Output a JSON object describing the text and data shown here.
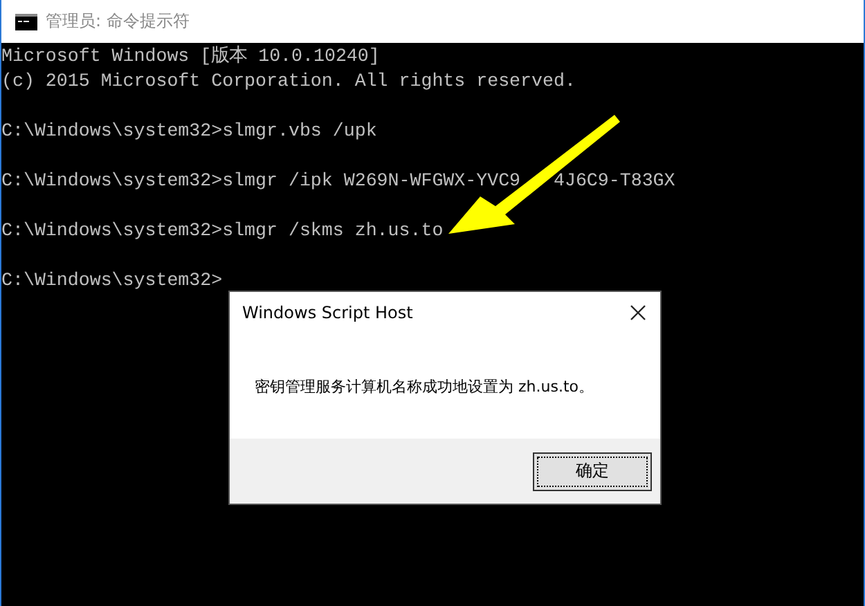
{
  "window": {
    "title": "管理员: 命令提示符"
  },
  "console": {
    "lines": [
      {
        "kind": "output",
        "parts": [
          "Microsoft Windows [版本 10.0.10240]"
        ]
      },
      {
        "kind": "output",
        "parts": [
          "(c) 2015 Microsoft Corporation. All rights reserved."
        ]
      },
      {
        "kind": "prompt",
        "parts": [
          "C:\\Windows\\system32>slmgr.vbs /upk"
        ]
      },
      {
        "kind": "prompt",
        "parts": [
          "C:\\Windows\\system32>slmgr /ipk W269N-WFGWX-YVC9",
          "4J6C9-T83GX"
        ]
      },
      {
        "kind": "prompt",
        "parts": [
          "C:\\Windows\\system32>slmgr /skms zh.us.to"
        ]
      },
      {
        "kind": "prompt",
        "parts": [
          "C:\\Windows\\system32>"
        ]
      }
    ]
  },
  "dialog": {
    "title": "Windows Script Host",
    "message": "密钥管理服务计算机名称成功地设置为 zh.us.to。",
    "buttons": [
      {
        "label": "确定",
        "selected": true
      }
    ]
  }
}
